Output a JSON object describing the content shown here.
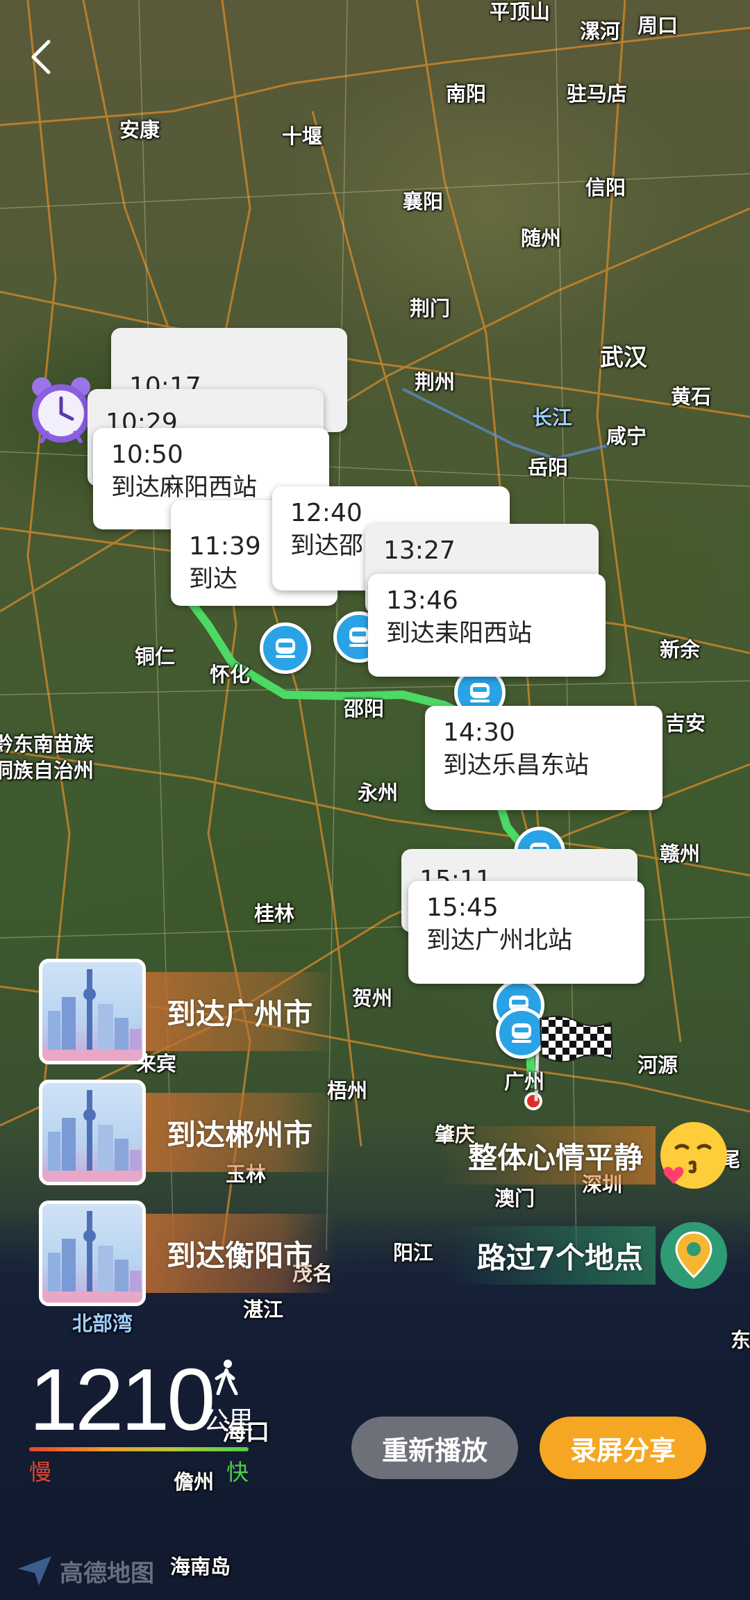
{
  "map": {
    "places": [
      {
        "name": "平顶山",
        "cls": ""
      },
      {
        "name": "漯河",
        "cls": ""
      },
      {
        "name": "周口",
        "cls": ""
      },
      {
        "name": "南阳",
        "cls": ""
      },
      {
        "name": "驻马店",
        "cls": ""
      },
      {
        "name": "安康",
        "cls": ""
      },
      {
        "name": "十堰",
        "cls": ""
      },
      {
        "name": "信阳",
        "cls": ""
      },
      {
        "name": "襄阳",
        "cls": ""
      },
      {
        "name": "随州",
        "cls": ""
      },
      {
        "name": "荆门",
        "cls": ""
      },
      {
        "name": "武汉",
        "cls": "big"
      },
      {
        "name": "荆州",
        "cls": ""
      },
      {
        "name": "黄石",
        "cls": ""
      },
      {
        "name": "长江",
        "cls": "blue"
      },
      {
        "name": "咸宁",
        "cls": ""
      },
      {
        "name": "岳阳",
        "cls": ""
      },
      {
        "name": "铜仁",
        "cls": ""
      },
      {
        "name": "怀化",
        "cls": ""
      },
      {
        "name": "邵阳",
        "cls": ""
      },
      {
        "name": "新余",
        "cls": ""
      },
      {
        "name": "吉安",
        "cls": ""
      },
      {
        "name": "黔东南苗族",
        "cls": ""
      },
      {
        "name": "侗族自治州",
        "cls": ""
      },
      {
        "name": "永州",
        "cls": ""
      },
      {
        "name": "赣州",
        "cls": ""
      },
      {
        "name": "桂林",
        "cls": ""
      },
      {
        "name": "贺州",
        "cls": ""
      },
      {
        "name": "来宾",
        "cls": ""
      },
      {
        "name": "梧州",
        "cls": ""
      },
      {
        "name": "河源",
        "cls": ""
      },
      {
        "name": "广州",
        "cls": ""
      },
      {
        "name": "玉林",
        "cls": ""
      },
      {
        "name": "肇庆",
        "cls": ""
      },
      {
        "name": "汕尾",
        "cls": ""
      },
      {
        "name": "澳门",
        "cls": ""
      },
      {
        "name": "深圳",
        "cls": ""
      },
      {
        "name": "阳江",
        "cls": ""
      },
      {
        "name": "茂名",
        "cls": ""
      },
      {
        "name": "湛江",
        "cls": ""
      },
      {
        "name": "北部湾",
        "cls": "blue"
      },
      {
        "name": "海口",
        "cls": ""
      },
      {
        "name": "儋州",
        "cls": ""
      },
      {
        "name": "海南岛",
        "cls": ""
      },
      {
        "name": "东",
        "cls": ""
      }
    ]
  },
  "timeline": [
    {
      "time": "10:17",
      "dest": ""
    },
    {
      "time": "10:29",
      "dest": ""
    },
    {
      "time": "10:50",
      "dest": "到达麻阳西站"
    },
    {
      "time": "11:39",
      "dest": "到达"
    },
    {
      "time": "12:40",
      "dest": "到达邵"
    },
    {
      "time": "13:27",
      "dest": ""
    },
    {
      "time": "13:46",
      "dest": "到达耒阳西站"
    },
    {
      "time": "14:30",
      "dest": "到达乐昌东站"
    },
    {
      "time": "15:11",
      "dest": ""
    },
    {
      "time": "15:45",
      "dest": "到达广州北站"
    }
  ],
  "city_badges": [
    {
      "label": "到达广州市"
    },
    {
      "label": "到达郴州市"
    },
    {
      "label": "到达衡阳市"
    }
  ],
  "summary": {
    "mood": "整体心情平静",
    "places": "路过7个地点"
  },
  "stats": {
    "distance": "1210",
    "unit": "公里",
    "slow": "慢",
    "fast": "快",
    "mode": "walk-icon"
  },
  "buttons": {
    "replay": "重新播放",
    "share": "录屏分享"
  },
  "logo": {
    "text": "高德地图"
  },
  "colors": {
    "route": "#4cd964",
    "marker": "#2aa3e6",
    "share_button": "#f5a623",
    "replay_button": "#6d7078"
  }
}
